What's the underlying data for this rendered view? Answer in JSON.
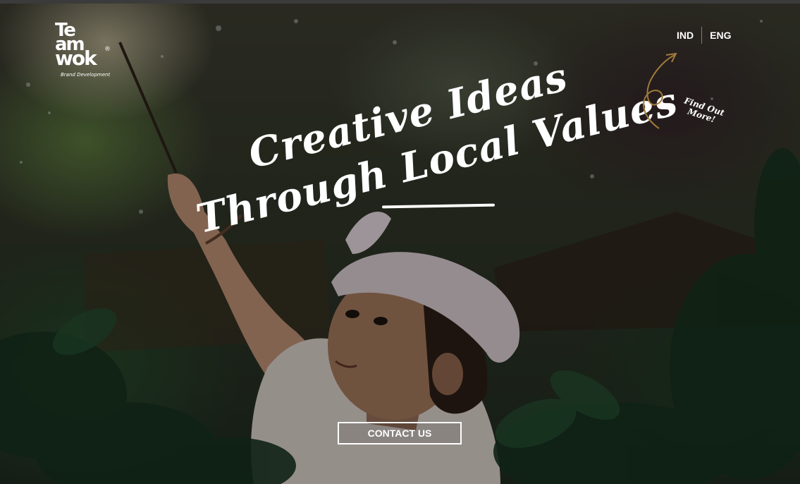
{
  "logo": {
    "line1": "Te",
    "line2": "am",
    "line3": "wok",
    "registered": "®",
    "tagline": "Brand Development"
  },
  "language": {
    "options": [
      "IND",
      "ENG"
    ]
  },
  "headline": {
    "line1": "Creative Ideas",
    "line2_part1": "Through",
    "line2_part2": "Local",
    "line2_part3": "Values"
  },
  "find_out": {
    "line1": "Find Out",
    "line2": "More!"
  },
  "cta": {
    "label": "CONTACT US"
  },
  "colors": {
    "accent": "#a07a3a",
    "text": "#ffffff"
  },
  "icons": {
    "arrow": "curved-arrow-icon"
  }
}
